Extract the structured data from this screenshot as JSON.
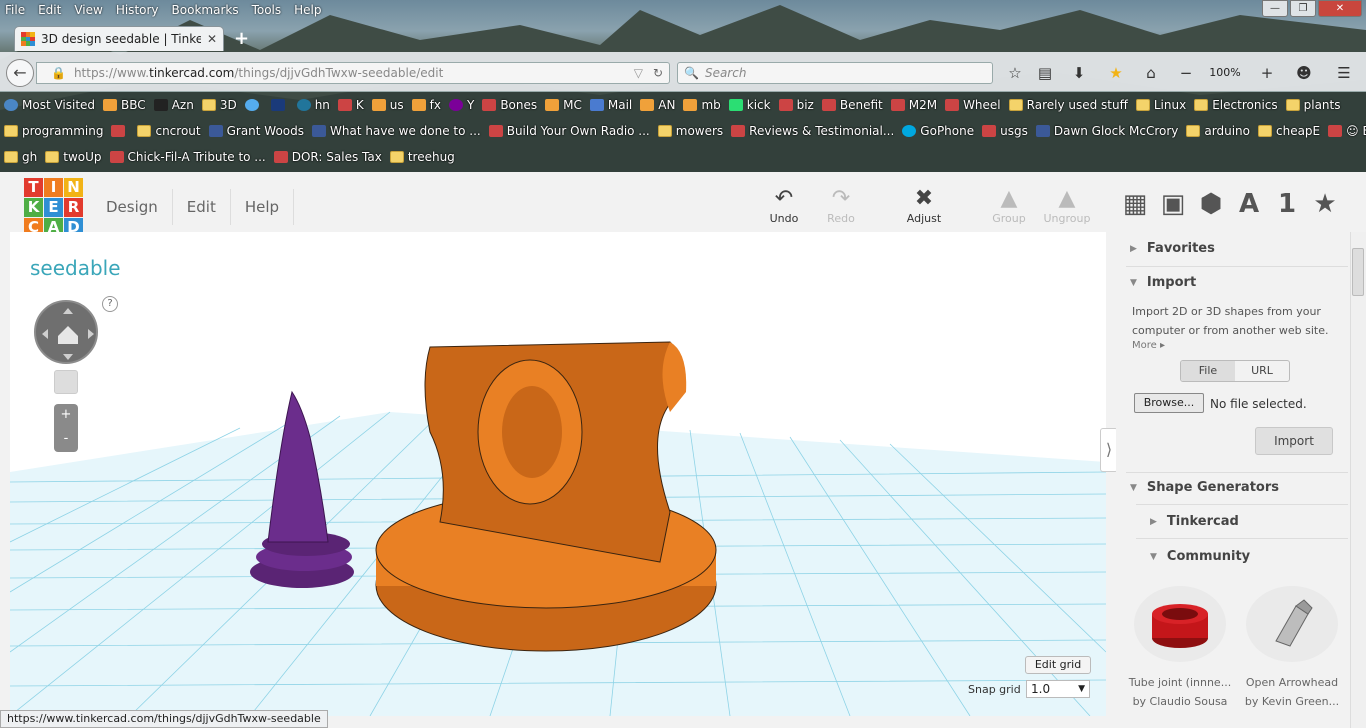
{
  "browser": {
    "menu": [
      "File",
      "Edit",
      "View",
      "History",
      "Bookmarks",
      "Tools",
      "Help"
    ],
    "tab_title": "3D design seedable | Tinker...",
    "url_prefix": "https://www.",
    "url_domain": "tinkercad.com",
    "url_path": "/things/djjvGdhTwxw-seedable/edit",
    "search_placeholder": "Search",
    "zoom": "100%",
    "bookmarks_row1": [
      {
        "label": "Most Visited",
        "icon": "globe"
      },
      {
        "label": "BBC",
        "icon": "feed"
      },
      {
        "label": "Azn",
        "icon": "amazon"
      },
      {
        "label": "3D",
        "icon": "folder"
      },
      {
        "label": "",
        "icon": "twitter"
      },
      {
        "label": "",
        "icon": "twc"
      },
      {
        "label": "hn",
        "icon": "wordpress"
      },
      {
        "label": "K",
        "icon": "site"
      },
      {
        "label": "us",
        "icon": "feed"
      },
      {
        "label": "fx",
        "icon": "feed"
      },
      {
        "label": "Y",
        "icon": "yahoo"
      },
      {
        "label": "Bones",
        "icon": "site"
      },
      {
        "label": "MC",
        "icon": "feed"
      },
      {
        "label": "Mail",
        "icon": "mail"
      },
      {
        "label": "AN",
        "icon": "feed"
      },
      {
        "label": "mb",
        "icon": "feed"
      },
      {
        "label": "kick",
        "icon": "kick"
      },
      {
        "label": "biz",
        "icon": "site"
      },
      {
        "label": "Benefit",
        "icon": "site"
      },
      {
        "label": "M2M",
        "icon": "site"
      },
      {
        "label": "Wheel",
        "icon": "site"
      },
      {
        "label": "Rarely used stuff",
        "icon": "folder"
      },
      {
        "label": "Linux",
        "icon": "folder"
      },
      {
        "label": "Electronics",
        "icon": "folder"
      },
      {
        "label": "plants",
        "icon": "folder"
      }
    ],
    "bookmarks_row2": [
      {
        "label": "programming",
        "icon": "folder"
      },
      {
        "label": "",
        "icon": "site"
      },
      {
        "label": "cncrout",
        "icon": "folder"
      },
      {
        "label": "Grant Woods",
        "icon": "facebook"
      },
      {
        "label": "What have we done to ...",
        "icon": "facebook"
      },
      {
        "label": "Build Your Own Radio ...",
        "icon": "site"
      },
      {
        "label": "mowers",
        "icon": "folder"
      },
      {
        "label": "Reviews & Testimonial...",
        "icon": "site"
      },
      {
        "label": "GoPhone",
        "icon": "att"
      },
      {
        "label": "usgs",
        "icon": "site"
      },
      {
        "label": "Dawn Glock McCrory",
        "icon": "facebook"
      },
      {
        "label": "arduino",
        "icon": "folder"
      },
      {
        "label": "cheapE",
        "icon": "folder"
      },
      {
        "label": "☺ Emoji People",
        "icon": "site"
      }
    ],
    "bookmarks_row3": [
      {
        "label": "gh",
        "icon": "folder"
      },
      {
        "label": "twoUp",
        "icon": "folder"
      },
      {
        "label": "Chick-Fil-A Tribute to ...",
        "icon": "site"
      },
      {
        "label": "DOR: Sales Tax",
        "icon": "site"
      },
      {
        "label": "treehug",
        "icon": "folder"
      }
    ],
    "status_url": "https://www.tinkercad.com/things/djjvGdhTwxw-seedable"
  },
  "app": {
    "logo_letters": [
      "T",
      "I",
      "N",
      "K",
      "E",
      "R",
      "C",
      "A",
      "D"
    ],
    "logo_colors": [
      "#e23b2e",
      "#f07c1f",
      "#f2b316",
      "#4fae45",
      "#2f8fd4",
      "#e23b2e",
      "#f07c1f",
      "#4fae45",
      "#2f8fd4"
    ],
    "menu": [
      "Design",
      "Edit",
      "Help"
    ],
    "tools": {
      "undo": "Undo",
      "redo": "Redo",
      "adjust": "Adjust",
      "group": "Group",
      "ungroup": "Ungroup"
    },
    "design_name": "seedable",
    "help_glyph": "?",
    "zoom_in": "+",
    "zoom_out": "-",
    "edit_grid": "Edit grid",
    "snap_label": "Snap grid",
    "snap_value": "1.0",
    "side_tabs": [
      "grid-icon",
      "cube-icon",
      "hexagon-icon",
      "A",
      "1",
      "★"
    ],
    "panel": {
      "favorites": "Favorites",
      "import": "Import",
      "import_text": "Import 2D or 3D shapes from your computer or from another web site.",
      "more": "More",
      "file_tab": "File",
      "url_tab": "URL",
      "browse": "Browse...",
      "no_file": "No file selected.",
      "import_button": "Import",
      "shape_generators": "Shape Generators",
      "tinkercad": "Tinkercad",
      "community": "Community",
      "items": [
        {
          "title": "Tube joint (innne...",
          "author": "by Claudio Sousa"
        },
        {
          "title": "Open Arrowhead",
          "author": "by Kevin Green..."
        }
      ]
    },
    "colors": {
      "accent": "#3aa6b9",
      "orange_shape": "#e98024",
      "purple_shape": "#6b2d8c",
      "grid": "#8ed3e6"
    }
  }
}
